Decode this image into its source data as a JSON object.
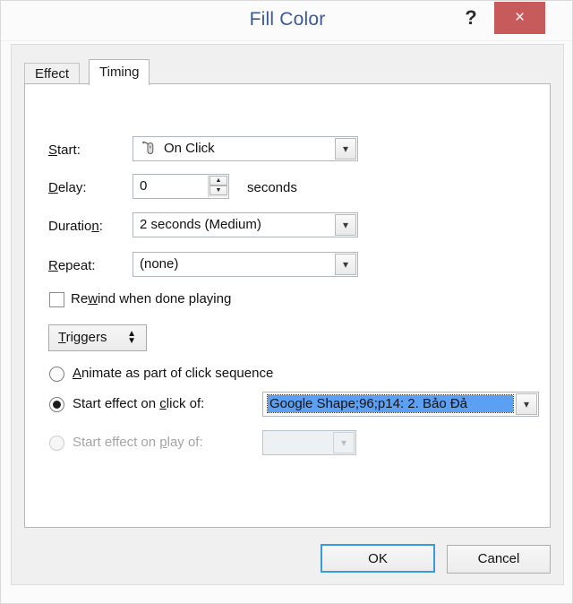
{
  "window": {
    "title": "Fill Color",
    "help_label": "?",
    "close_label": "×",
    "close_color": "#c75b5b",
    "title_color": "#3b5998"
  },
  "tabs": [
    {
      "label": "Effect",
      "active": false
    },
    {
      "label": "Timing",
      "active": true
    }
  ],
  "form": {
    "start": {
      "label": "Start:",
      "mnemonic": "S",
      "value": "On Click",
      "icon": "mouse-click-icon"
    },
    "delay": {
      "label": "Delay:",
      "mnemonic": "D",
      "value": "0",
      "units": "seconds"
    },
    "duration": {
      "label": "Duration:",
      "mnemonic": "n",
      "value": "2 seconds (Medium)"
    },
    "repeat": {
      "label": "Repeat:",
      "mnemonic": "R",
      "value": "(none)"
    },
    "rewind": {
      "label": "Rewind when done playing",
      "checked": false
    },
    "triggers": {
      "label": "Triggers",
      "expander": "⬍"
    },
    "animate_click_sequence": {
      "label": "Animate as part of click sequence",
      "selected": false
    },
    "start_on_click": {
      "label": "Start effect on click of:",
      "selected": true,
      "value": "Google Shape;96;p14: 2. Bảo Đả"
    },
    "start_on_play": {
      "label": "Start effect on play of:",
      "selected": false,
      "disabled": true,
      "value": ""
    }
  },
  "footer": {
    "ok_label": "OK",
    "cancel_label": "Cancel"
  }
}
